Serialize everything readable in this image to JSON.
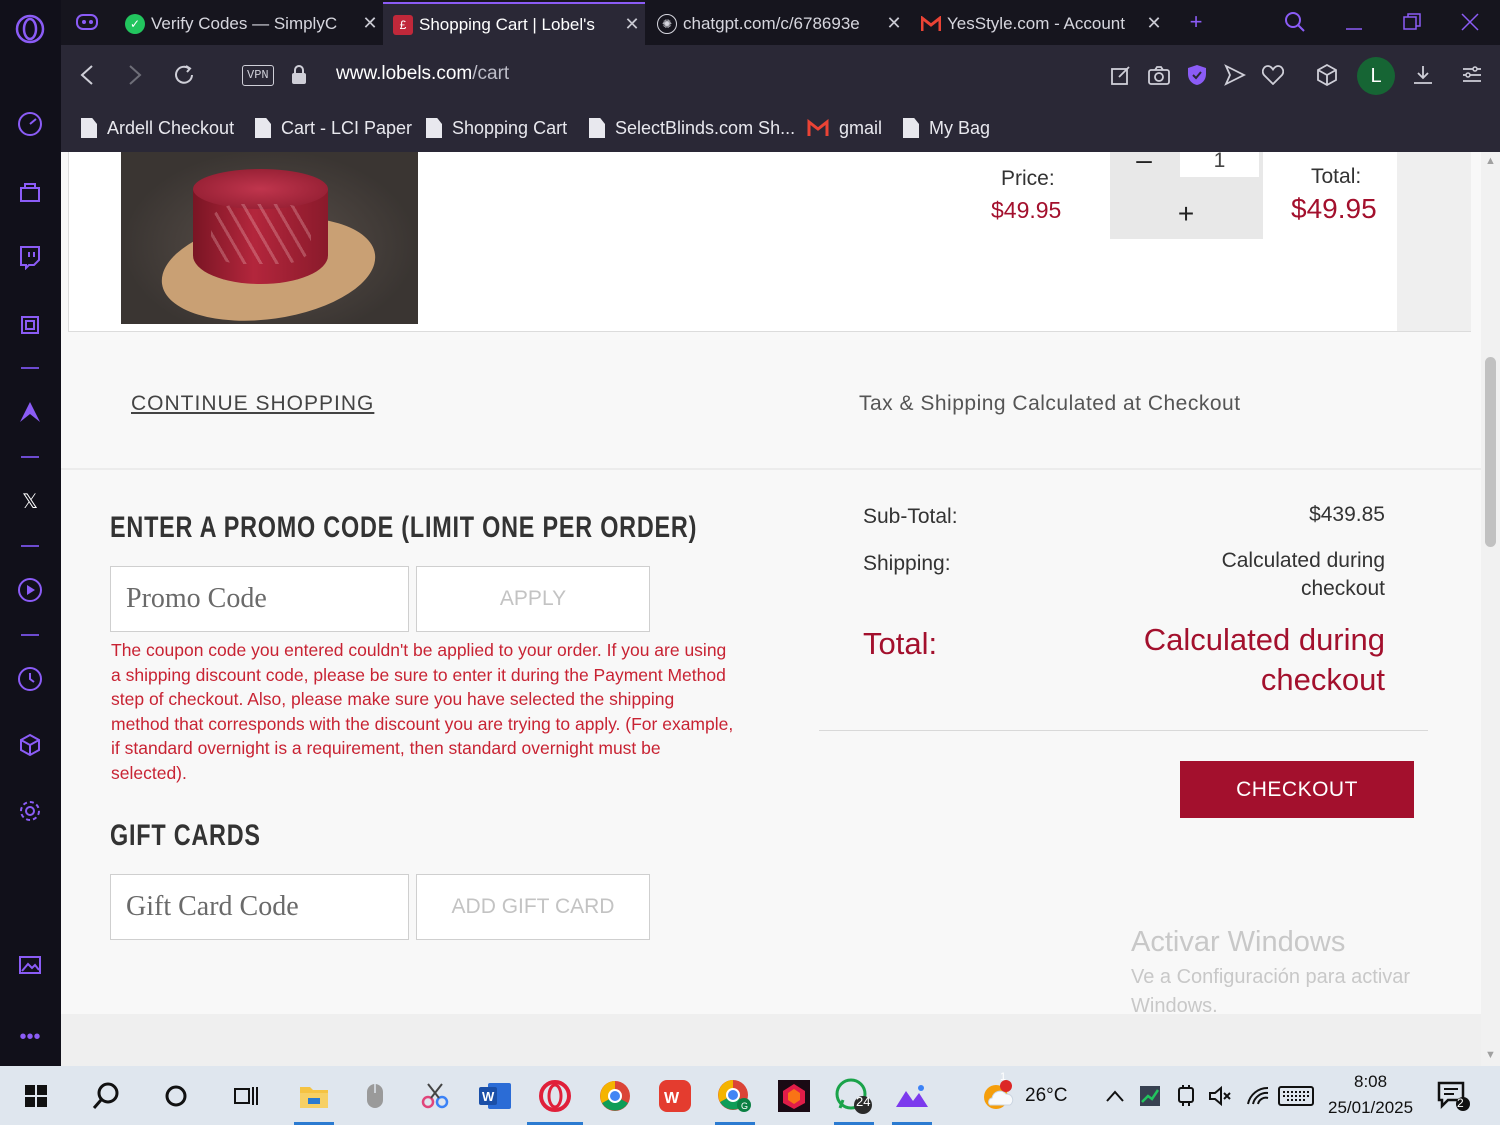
{
  "browser": {
    "tabs": [
      {
        "title": "Verify Codes — SimplyC",
        "icon": "simplycodes-icon",
        "active": false
      },
      {
        "title": "Shopping Cart | Lobel's",
        "icon": "lobels-icon",
        "active": true
      },
      {
        "title": "chatgpt.com/c/678693e",
        "icon": "chatgpt-icon",
        "active": false
      },
      {
        "title": "YesStyle.com - Account",
        "icon": "gmail-icon",
        "active": false
      }
    ],
    "address": {
      "host": "www.lobels.com",
      "path": "/cart"
    },
    "vpn_label": "VPN",
    "profile_initial": "L",
    "bookmarks": [
      {
        "label": "Ardell Checkout"
      },
      {
        "label": "Cart - LCI Paper"
      },
      {
        "label": "Shopping Cart"
      },
      {
        "label": "SelectBlinds.com Sh..."
      },
      {
        "label": "gmail"
      },
      {
        "label": "My Bag"
      }
    ]
  },
  "cart_item": {
    "price_label": "Price:",
    "price": "$49.95",
    "quantity": "1",
    "minus": "–",
    "plus": "+",
    "total_label": "Total:",
    "total": "$49.95"
  },
  "band": {
    "continue_label": "CONTINUE SHOPPING",
    "tax_note": "Tax & Shipping Calculated at Checkout"
  },
  "promo": {
    "heading": "ENTER A PROMO CODE (LIMIT ONE PER ORDER)",
    "placeholder": "Promo Code",
    "apply_label": "APPLY",
    "error": "The coupon code you entered couldn't be applied to your order. If you are using a shipping discount code, please be sure to enter it during the Payment Method step of checkout. Also, please make sure you have selected the shipping method that corresponds with the discount you are trying to apply. (For example, if standard overnight is a requirement, then standard overnight must be selected)."
  },
  "gift": {
    "heading": "GIFT CARDS",
    "placeholder": "Gift Card Code",
    "button_label": "ADD GIFT CARD"
  },
  "summary": {
    "subtotal_label": "Sub-Total:",
    "subtotal": "$439.85",
    "shipping_label": "Shipping:",
    "shipping_line1": "Calculated during",
    "shipping_line2": "checkout",
    "total_label": "Total:",
    "total_line1": "Calculated during",
    "total_line2": "checkout",
    "checkout_label": "CHECKOUT"
  },
  "watermark": {
    "title": "Activar Windows",
    "subtitle": "Ve a Configuración para activar Windows."
  },
  "taskbar": {
    "weather_temp": "26°C",
    "weather_alert": "1",
    "time": "8:08",
    "date": "25/01/2025",
    "whatsapp_badge": "24",
    "notifications_badge": "2"
  },
  "colors": {
    "brand": "#a3102d",
    "error": "#c82333",
    "opera_accent": "#8b5cf6"
  }
}
